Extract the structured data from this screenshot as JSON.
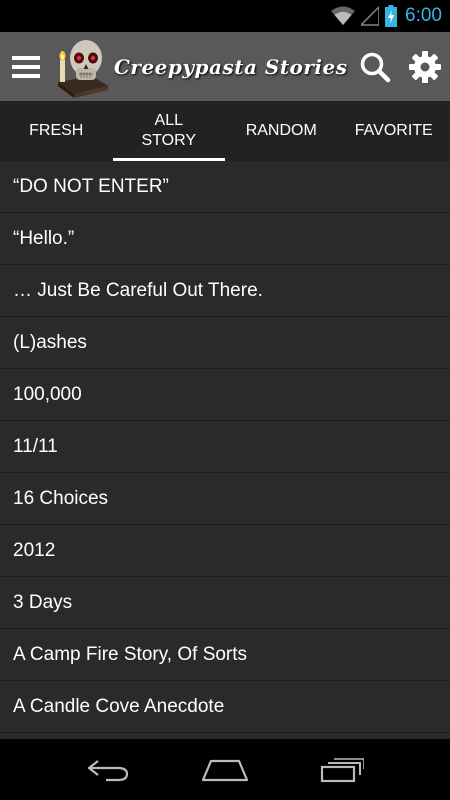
{
  "status_bar": {
    "time": "6:00",
    "wifi_icon": "wifi-icon",
    "signal_icon": "signal-icon",
    "battery_icon": "battery-charging-icon",
    "accent_color": "#33b5e5"
  },
  "action_bar": {
    "title": "Creepypasta Stories",
    "menu_icon": "hamburger-menu-icon",
    "logo_icon": "skull-logo-icon",
    "search_icon": "search-icon",
    "settings_icon": "gear-icon"
  },
  "tabs": [
    {
      "label": "FRESH"
    },
    {
      "label": "ALL STORY",
      "active": true
    },
    {
      "label": "RANDOM"
    },
    {
      "label": "FAVORITE"
    }
  ],
  "stories": [
    "“DO NOT ENTER”",
    "“Hello.”",
    "… Just Be Careful Out There.",
    "(L)ashes",
    "100,000",
    "11/11",
    "16 Choices",
    "2012",
    "3 Days",
    "A Camp Fire Story, Of Sorts",
    "A Candle Cove Anecdote"
  ],
  "nav_bar": {
    "back_icon": "back-icon",
    "home_icon": "home-icon",
    "recents_icon": "recent-apps-icon"
  }
}
